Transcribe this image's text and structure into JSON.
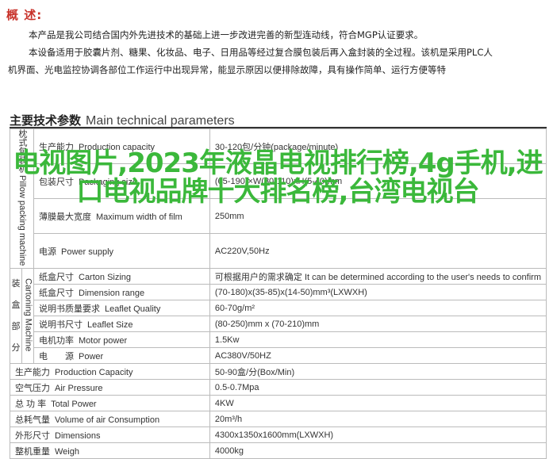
{
  "overview": {
    "title": "概  述:",
    "lines": [
      "本产品是我公司结合国内外先进技术的基础上进一步改进完善的新型连动线，符合MGP认证要求。",
      "本设备适用于胶囊片剂、糖果、化妆品、电子、日用品等经过复合膜包装后再入盒封装的全过程。该机是采用PLC人",
      "机界面、光电监控协调各部位工作运行中出现异常，能显示原因以便排除故障，具有操作简单、运行方便等特"
    ]
  },
  "params": {
    "title_cn": "主要技术参数",
    "title_en": "Main technical parameters",
    "pillow_label": "枕式包装机 Pillow packing machine",
    "carton_cn": [
      "装",
      "盒",
      "部",
      "分"
    ],
    "carton_en": "Cartoning Machine",
    "pillow_rows": [
      {
        "cn": "生产能力",
        "en": "Production capacity",
        "value": "30-120包/分钟(package/minute)"
      },
      {
        "cn": "包装尺寸",
        "en": "Packaging size",
        "value": "(65-190)×W(30-110)xH(5-40)mm"
      },
      {
        "cn": "薄膜最大宽度",
        "en": "Maximum width of film",
        "value": "250mm"
      },
      {
        "cn": "电源",
        "en": "Power supply",
        "value": "AC220V,50Hz"
      }
    ],
    "carton_rows": [
      {
        "cn": "纸盒尺寸",
        "en": "Carton Sizing",
        "value": "可根据用户的需求确定 It can be determined according to the user's needs to confirm"
      },
      {
        "cn": "纸盒尺寸",
        "en": "Dimension range",
        "value": "(70-180)x(35-85)x(14-50)mm³(LXWXH)"
      },
      {
        "cn": "说明书质量要求",
        "en": "Leaflet Quality",
        "value": "60-70g/m²"
      },
      {
        "cn": "说明书尺寸",
        "en": "Leaflet Size",
        "value": "(80-250)mm x (70-210)mm"
      },
      {
        "cn": "电机功率",
        "en": "Motor power",
        "value": "1.5Kw"
      },
      {
        "cn": "电　　源",
        "en": "Power",
        "value": "AC380V/50HZ"
      }
    ],
    "rows": [
      {
        "cn": "生产能力",
        "en": "Production Capacity",
        "value": "50-90盒/分(Box/Min)"
      },
      {
        "cn": "空气压力",
        "en": "Air Pressure",
        "value": "0.5-0.7Mpa"
      },
      {
        "cn": "总 功 率",
        "en": "Total Power",
        "value": "4KW"
      },
      {
        "cn": "总耗气量",
        "en": "Volume of air Consumption",
        "value": "20m³/h"
      },
      {
        "cn": "外形尺寸",
        "en": "Dimensions",
        "value": "4300x1350x1600mm(LXWXH)"
      },
      {
        "cn": "整机重量",
        "en": "Weigh",
        "value": "4000kg"
      }
    ]
  },
  "overlay_text": "电视图片,2023年液晶电视排行榜,4g手机,进口电视品牌十大排名榜,台湾电视台",
  "colors": {
    "title": "#c8322a",
    "overlay": "#3bb83b",
    "border": "#bbbbbb"
  }
}
